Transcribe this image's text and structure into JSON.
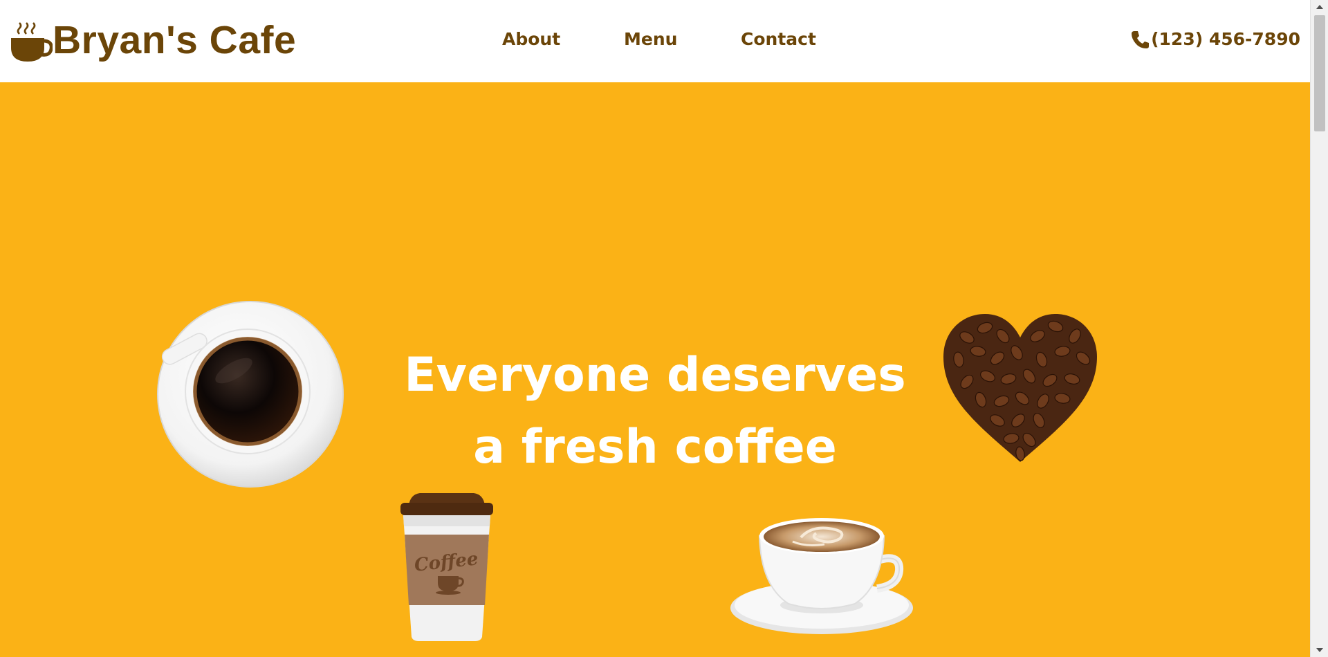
{
  "header": {
    "logo_text": "Bryan's Cafe",
    "logo_icon": "coffee-cup-icon",
    "nav": {
      "about": "About",
      "menu": "Menu",
      "contact": "Contact"
    },
    "phone": {
      "icon": "phone-icon",
      "number": "(123) 456-7890"
    }
  },
  "hero": {
    "headline_line1": "Everyone deserves",
    "headline_line2": "a fresh coffee",
    "images": [
      "coffee-cup-top-view",
      "coffee-bean-heart",
      "paper-coffee-cup",
      "latte-cup"
    ],
    "paper_cup_label": "Coffee"
  },
  "colors": {
    "brand_brown": "#6b4508",
    "hero_background": "#fbb216",
    "headline_text": "#ffffff"
  }
}
